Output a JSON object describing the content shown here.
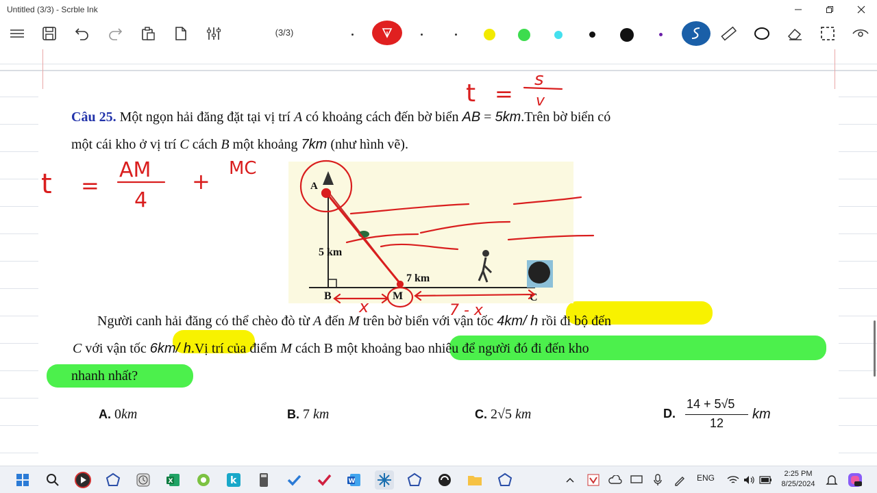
{
  "window": {
    "title": "Untitled (3/3) - Scrble Ink"
  },
  "toolbar": {
    "page_counter": "(3/3)",
    "pen_colors": [
      "#d91e1e",
      "#f2ea00",
      "#3ddc4e",
      "#44e0ee",
      "#111111",
      "#111111",
      "#6a1fa8"
    ],
    "active_tool_color": "#1a5fa8"
  },
  "document": {
    "question_label": "Câu 25.",
    "line1_text": " Một ngọn hải đăng đặt tại vị trí ",
    "line1_A": "A",
    "line1_text2": " có khoảng cách đến bờ biển ",
    "line1_AB": "AB",
    "line1_eq": " = ",
    "line1_dist": "5km",
    "line1_tail": ".Trên bờ biển có",
    "line2_text": "một cái kho ở vị trí ",
    "line2_C": "C",
    "line2_text2": " cách ",
    "line2_B": "B",
    "line2_text3": " một khoảng ",
    "line2_dist": "7km",
    "line2_tail": " (như hình vẽ).",
    "para_l1_a": "Người canh hải đăng có thể chèo đò từ ",
    "para_l1_A": "A",
    "para_l1_b": "  đến ",
    "para_l1_M": "M",
    "para_l1_c": "  trên bờ biển với vận tốc ",
    "para_l1_speed": "4km/ h",
    "para_l1_d": " rồi đi bộ đến",
    "para_l2_C": "C",
    "para_l2_a": "  với vận tốc ",
    "para_l2_speed": "6km/ h",
    "para_l2_b": ".Vị trí của điểm ",
    "para_l2_M": "M",
    "para_l2_c": " cách B một khoảng bao nhiêu để người đó đi đến kho",
    "para_l3": "nhanh nhất?",
    "figure": {
      "label_A": "A",
      "label_B": "B",
      "label_M": "M",
      "label_C": "C",
      "label_5km": "5 km",
      "label_7km": "7 km"
    },
    "answers": [
      {
        "letter": "A.",
        "value": "0",
        "unit": "km"
      },
      {
        "letter": "B.",
        "value": "7",
        "unit": "km"
      },
      {
        "letter": "C.",
        "value": "2√5",
        "unit": "km"
      },
      {
        "letter": "D.",
        "numerator": "14 + 5√5",
        "denominator": "12",
        "unit": "km"
      }
    ]
  },
  "ink": {
    "eq_top_t": "t",
    "eq_top_eq": "=",
    "eq_top_num": "s",
    "eq_top_den": "v",
    "eq_left_t": "t",
    "eq_left_eq": "=",
    "eq_left_num": "AM",
    "eq_left_den": "4",
    "eq_left_plus": "+",
    "eq_left_mc": "MC",
    "label_x": "x",
    "label_7minusx": "7 - x"
  },
  "taskbar": {
    "lang": "ENG",
    "time": "2:25 PM",
    "date": "8/25/2024",
    "icons": [
      "windows-start-icon",
      "search-icon",
      "media-player-icon",
      "app-icon",
      "clock-app-icon",
      "excel-icon",
      "browser-icon",
      "k-app-icon",
      "calculator-icon",
      "todo-icon",
      "scrble-ink-icon",
      "word-icon",
      "snipping-icon",
      "app-icon-2",
      "app-icon-3",
      "file-explorer-icon",
      "app-icon-4"
    ]
  }
}
